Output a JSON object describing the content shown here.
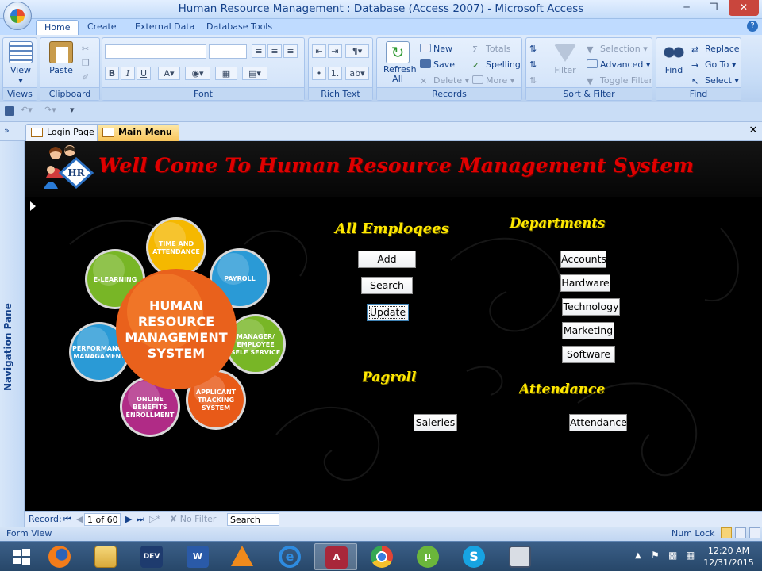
{
  "window": {
    "title": "Human Resource Management : Database (Access 2007) - Microsoft Access"
  },
  "ribbon": {
    "tabs": [
      "Home",
      "Create",
      "External Data",
      "Database Tools"
    ],
    "groups": {
      "views": {
        "label": "Views",
        "view": "View"
      },
      "clipboard": {
        "label": "Clipboard",
        "paste": "Paste"
      },
      "font": {
        "label": "Font"
      },
      "rich_text": {
        "label": "Rich Text"
      },
      "records": {
        "label": "Records",
        "refresh": "Refresh All",
        "new": "New",
        "save": "Save",
        "delete": "Delete",
        "totals": "Totals",
        "spelling": "Spelling",
        "more": "More"
      },
      "sort_filter": {
        "label": "Sort & Filter",
        "filter": "Filter",
        "selection": "Selection",
        "advanced": "Advanced",
        "toggle": "Toggle Filter"
      },
      "find": {
        "label": "Find",
        "find": "Find",
        "replace": "Replace",
        "goto": "Go To",
        "select": "Select"
      }
    }
  },
  "doc_tabs": [
    "Login Page",
    "Main Menu"
  ],
  "nav_pane": {
    "label": "Navigation Pane"
  },
  "form": {
    "welcome": "Well Come To Human Resource Management System",
    "logo_text": "HR",
    "graphic": {
      "center": [
        "HUMAN",
        "RESOURCE",
        "MANAGEMENT",
        "SYSTEM"
      ],
      "petals": [
        {
          "lines": [
            "TIME AND",
            "ATTENDANCE"
          ],
          "color": "#f5b800"
        },
        {
          "lines": [
            "PAYROLL"
          ],
          "color": "#2a9ad6"
        },
        {
          "lines": [
            "MANAGER/",
            "EMPLOYEE",
            "SELF SERVICE"
          ],
          "color": "#78b626"
        },
        {
          "lines": [
            "APPLICANT",
            "TRACKING",
            "SYSTEM"
          ],
          "color": "#e85a18"
        },
        {
          "lines": [
            "ONLINE",
            "BENEFITS",
            "ENROLLMENT"
          ],
          "color": "#b02b86"
        },
        {
          "lines": [
            "PERFORMANCE",
            "MANAGAMENT"
          ],
          "color": "#2a9ad6"
        },
        {
          "lines": [
            "E-LEARNING"
          ],
          "color": "#78b626"
        }
      ]
    },
    "sections": {
      "employees": {
        "title": "All Emploqees",
        "buttons": [
          "Add",
          "Search",
          "Update"
        ]
      },
      "departments": {
        "title": "Departments",
        "buttons": [
          "Accounts",
          "Hardware",
          "Technology",
          "Marketing",
          "Software"
        ]
      },
      "payroll": {
        "title": "Pagroll",
        "buttons": [
          "Saleries"
        ]
      },
      "attendance": {
        "title": "Attendance",
        "buttons": [
          "Attendance"
        ]
      }
    }
  },
  "record_nav": {
    "label": "Record:",
    "position": "1 of 60",
    "filter": "No Filter",
    "search": "Search"
  },
  "status": {
    "left": "Form View",
    "right": "Num Lock"
  },
  "taskbar": {
    "time": "12:20 AM",
    "date": "12/31/2015"
  }
}
